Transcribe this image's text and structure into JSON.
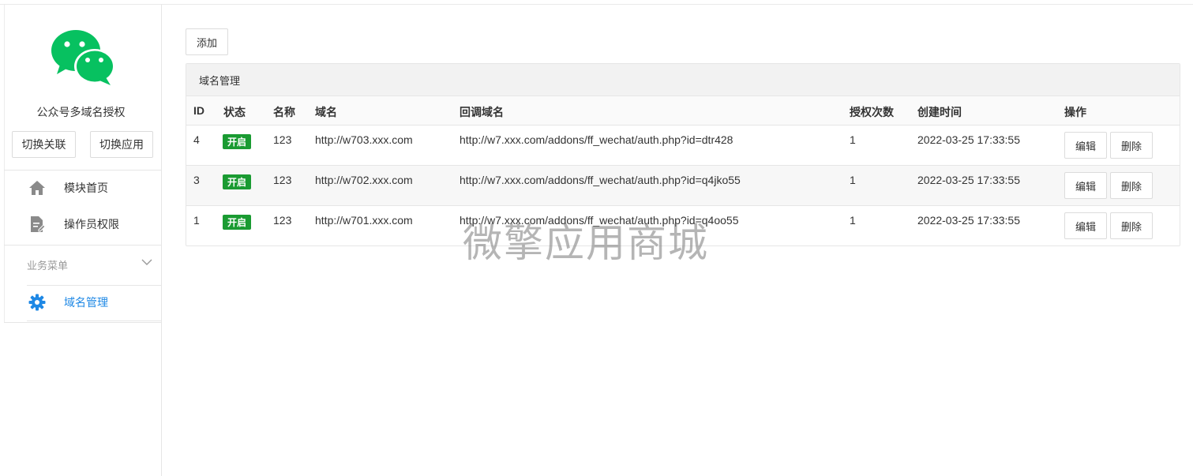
{
  "sidebar": {
    "app_name": "公众号多域名授权",
    "switch_assoc_label": "切换关联",
    "switch_app_label": "切换应用",
    "nav": [
      {
        "label": "模块首页",
        "icon": "home-icon"
      },
      {
        "label": "操作员权限",
        "icon": "document-edit-icon"
      }
    ],
    "menu_group_label": "业务菜单",
    "active_item": {
      "label": "域名管理",
      "icon": "gear-icon"
    }
  },
  "toolbar": {
    "add_label": "添加"
  },
  "panel": {
    "title": "域名管理",
    "columns": [
      "ID",
      "状态",
      "名称",
      "域名",
      "回调域名",
      "授权次数",
      "创建时间",
      "操作"
    ],
    "rows": [
      {
        "id": "4",
        "status": "开启",
        "name": "123",
        "domain": "http://w703.xxx.com",
        "callback": "http://w7.xxx.com/addons/ff_wechat/auth.php?id=dtr428",
        "count": "1",
        "created": "2022-03-25 17:33:55",
        "edit": "编辑",
        "delete": "删除"
      },
      {
        "id": "3",
        "status": "开启",
        "name": "123",
        "domain": "http://w702.xxx.com",
        "callback": "http://w7.xxx.com/addons/ff_wechat/auth.php?id=q4jko55",
        "count": "1",
        "created": "2022-03-25 17:33:55",
        "edit": "编辑",
        "delete": "删除"
      },
      {
        "id": "1",
        "status": "开启",
        "name": "123",
        "domain": "http://w701.xxx.com",
        "callback": "http://w7.xxx.com/addons/ff_wechat/auth.php?id=q4oo55",
        "count": "1",
        "created": "2022-03-25 17:33:55",
        "edit": "编辑",
        "delete": "删除"
      }
    ]
  },
  "watermark": "微擎应用商城",
  "colors": {
    "wechat_green": "#07c160",
    "status_green": "#1a9b32",
    "active_blue": "#1e88e5"
  }
}
